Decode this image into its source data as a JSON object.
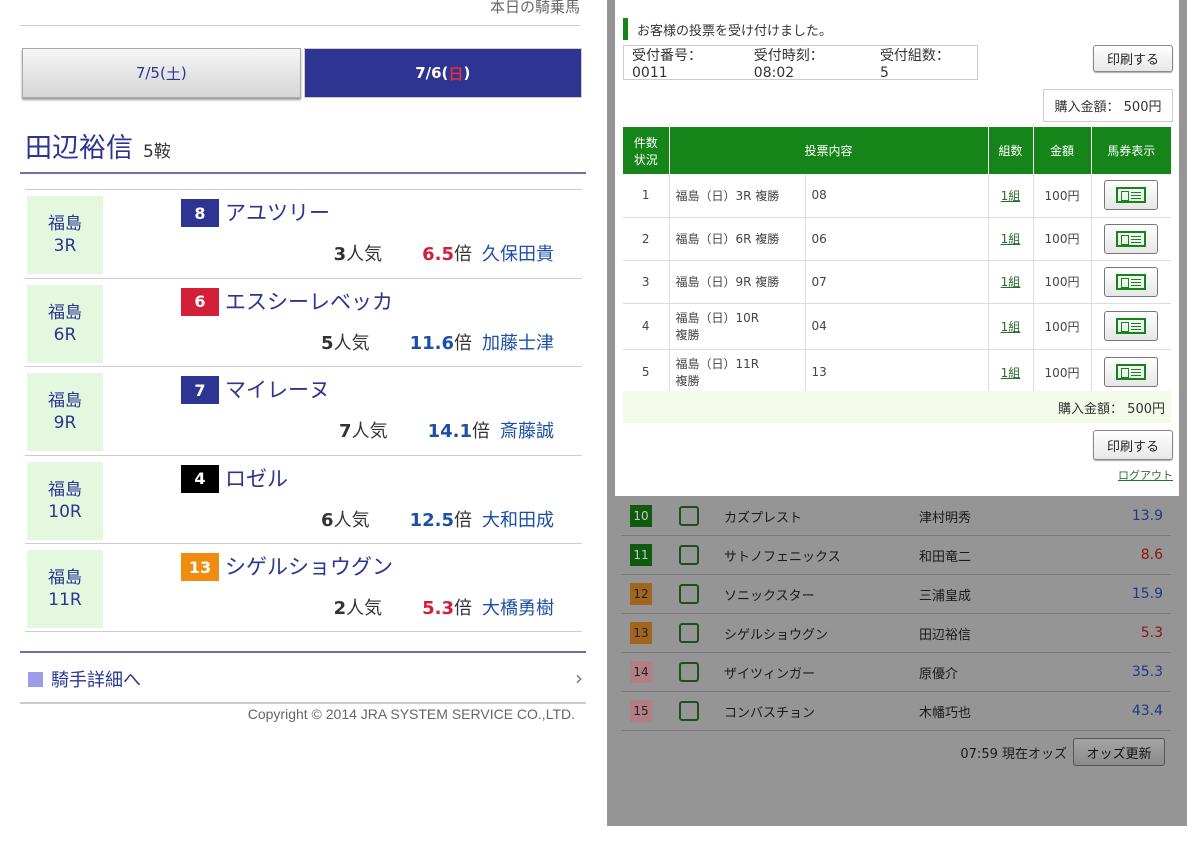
{
  "left": {
    "top_cut_text": "本日の騎乗馬",
    "date_tabs": [
      {
        "prefix": "7/5(",
        "day": "土",
        "suffix": ")"
      },
      {
        "prefix": "7/6(",
        "day": "日",
        "suffix": ")"
      }
    ],
    "jockey": {
      "name": "田辺裕信",
      "count": "5鞍"
    },
    "rides": [
      {
        "venue": "福島",
        "race": "3R",
        "num": "8",
        "horse": "アユツリー",
        "pop_num": "3",
        "pop_suffix": "人気",
        "odds": "6.5",
        "odds_suffix": "倍",
        "jockey": "久保田貴",
        "num_color": "#2d3492",
        "odds_color": "red"
      },
      {
        "venue": "福島",
        "race": "6R",
        "num": "6",
        "horse": "エスシーレベッカ",
        "pop_num": "5",
        "pop_suffix": "人気",
        "odds": "11.6",
        "odds_suffix": "倍",
        "jockey": "加藤士津",
        "num_color": "#d21f3a",
        "odds_color": "blue"
      },
      {
        "venue": "福島",
        "race": "9R",
        "num": "7",
        "horse": "マイレーヌ",
        "pop_num": "7",
        "pop_suffix": "人気",
        "odds": "14.1",
        "odds_suffix": "倍",
        "jockey": "斎藤誠",
        "num_color": "#2d3492",
        "odds_color": "blue"
      },
      {
        "venue": "福島",
        "race": "10R",
        "num": "4",
        "horse": "ロゼル",
        "pop_num": "6",
        "pop_suffix": "人気",
        "odds": "12.5",
        "odds_suffix": "倍",
        "jockey": "大和田成",
        "num_color": "#000000",
        "odds_color": "blue"
      },
      {
        "venue": "福島",
        "race": "11R",
        "num": "13",
        "horse": "シゲルショウグン",
        "pop_num": "2",
        "pop_suffix": "人気",
        "odds": "5.3",
        "odds_suffix": "倍",
        "jockey": "大橋勇樹",
        "num_color": "#f08c10",
        "odds_color": "red"
      }
    ],
    "detail_link": "騎手詳細へ",
    "copyright": "Copyright © 2014 JRA SYSTEM SERVICE CO.,LTD."
  },
  "right": {
    "message": "お客様の投票を受け付けました。",
    "receipt_no": "受付番号： 0011",
    "receipt_time": "受付時刻： 08:02",
    "receipt_sets": "受付組数： 5",
    "print_label": "印刷する",
    "total": "購入金額： 500円",
    "table_headers": {
      "status_line1": "件数",
      "status_line2": "状況",
      "content": "投票内容",
      "sets": "組数",
      "amount": "金額",
      "ticket": "馬券表示"
    },
    "bets": [
      {
        "no": "1",
        "race_line1": "福島（日）3R 複勝",
        "race_line2": "",
        "horse": "08",
        "sets": "1組",
        "amount": "100円"
      },
      {
        "no": "2",
        "race_line1": "福島（日）6R 複勝",
        "race_line2": "",
        "horse": "06",
        "sets": "1組",
        "amount": "100円"
      },
      {
        "no": "3",
        "race_line1": "福島（日）9R 複勝",
        "race_line2": "",
        "horse": "07",
        "sets": "1組",
        "amount": "100円"
      },
      {
        "no": "4",
        "race_line1": "福島（日）10R",
        "race_line2": "複勝",
        "horse": "04",
        "sets": "1組",
        "amount": "100円"
      },
      {
        "no": "5",
        "race_line1": "福島（日）11R",
        "race_line2": "複勝",
        "horse": "13",
        "sets": "1組",
        "amount": "100円"
      }
    ],
    "logout": "ログアウト",
    "odds_rows": [
      {
        "num": "10",
        "name": "カズプレスト",
        "jockey": "津村明秀",
        "odds": "13.9",
        "num_bg": "#0e5a0e",
        "num_fg": "#c8c8c8",
        "odds_color": "blue"
      },
      {
        "num": "11",
        "name": "サトノフェニックス",
        "jockey": "和田竜二",
        "odds": "8.6",
        "num_bg": "#0e5a0e",
        "num_fg": "#c8c8c8",
        "odds_color": "red"
      },
      {
        "num": "12",
        "name": "ソニックスター",
        "jockey": "三浦皇成",
        "odds": "15.9",
        "num_bg": "#a1661e",
        "num_fg": "#222222",
        "odds_color": "blue"
      },
      {
        "num": "13",
        "name": "シゲルショウグン",
        "jockey": "田辺裕信",
        "odds": "5.3",
        "num_bg": "#a1661e",
        "num_fg": "#222222",
        "odds_color": "red"
      },
      {
        "num": "14",
        "name": "ザイツィンガー",
        "jockey": "原優介",
        "odds": "35.3",
        "num_bg": "#b27f86",
        "num_fg": "#222222",
        "odds_color": "blue"
      },
      {
        "num": "15",
        "name": "コンバスチョン",
        "jockey": "木幡巧也",
        "odds": "43.4",
        "num_bg": "#b27f86",
        "num_fg": "#222222",
        "odds_color": "blue"
      }
    ],
    "odds_time": "07:59 現在オッズ",
    "update_label": "オッズ更新"
  }
}
